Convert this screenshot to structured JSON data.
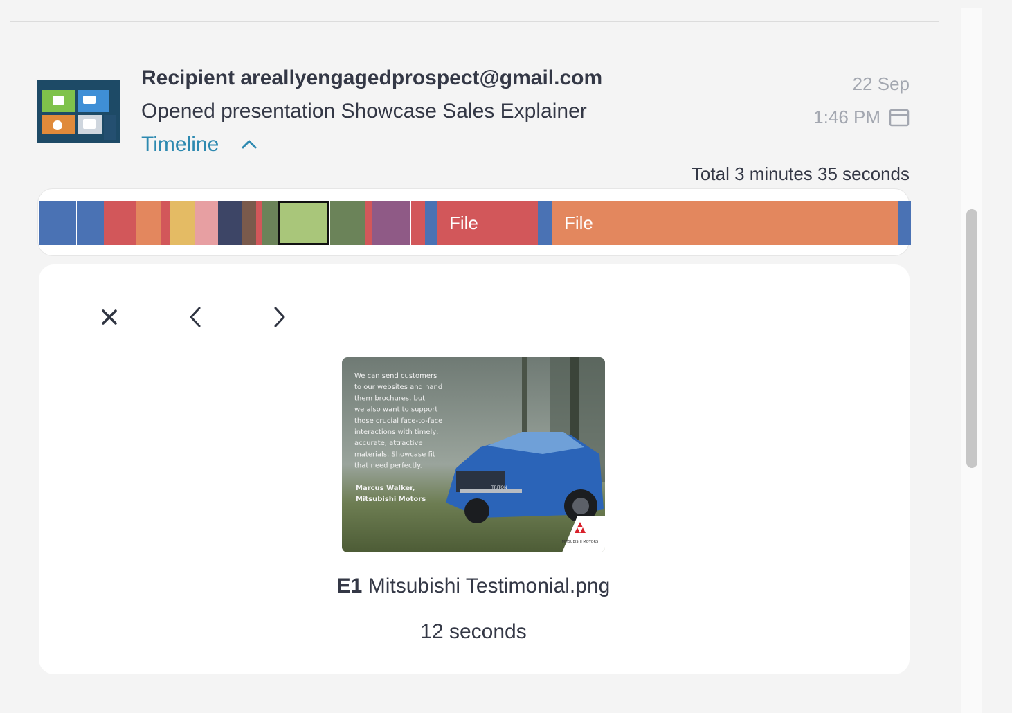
{
  "activity": {
    "recipient_label": "Recipient",
    "recipient_email": "areallyengagedprospect@gmail.com",
    "action": "Opened presentation Showcase Sales Explainer",
    "timeline_label": "Timeline",
    "date": "22 Sep",
    "time": "1:46 PM",
    "total": "Total 3 minutes 35 seconds"
  },
  "timeline": {
    "segments": [
      {
        "color": "#4a72b4",
        "label": "",
        "start": 0.0,
        "end": 0.043
      },
      {
        "color": "#4a72b4",
        "label": "",
        "start": 0.044,
        "end": 0.075
      },
      {
        "color": "#d2575a",
        "label": "",
        "start": 0.075,
        "end": 0.112
      },
      {
        "color": "#e3875e",
        "label": "",
        "start": 0.112,
        "end": 0.14
      },
      {
        "color": "#d2575a",
        "label": "",
        "start": 0.14,
        "end": 0.151
      },
      {
        "color": "#e4bb64",
        "label": "",
        "start": 0.151,
        "end": 0.179
      },
      {
        "color": "#e79fa2",
        "label": "",
        "start": 0.179,
        "end": 0.206
      },
      {
        "color": "#3d4566",
        "label": "",
        "start": 0.206,
        "end": 0.234
      },
      {
        "color": "#7a5a4c",
        "label": "",
        "start": 0.234,
        "end": 0.25
      },
      {
        "color": "#d2575a",
        "label": "",
        "start": 0.25,
        "end": 0.257
      },
      {
        "color": "#6b8359",
        "label": "",
        "start": 0.257,
        "end": 0.275
      },
      {
        "color": "#a9c67a",
        "label": "",
        "start": 0.275,
        "end": 0.335,
        "selected": true
      },
      {
        "color": "#6b8359",
        "label": "",
        "start": 0.335,
        "end": 0.375
      },
      {
        "color": "#d2575a",
        "label": "",
        "start": 0.375,
        "end": 0.384
      },
      {
        "color": "#8f5a86",
        "label": "",
        "start": 0.384,
        "end": 0.428
      },
      {
        "color": "#d2575a",
        "label": "",
        "start": 0.428,
        "end": 0.444
      },
      {
        "color": "#4a72b4",
        "label": "",
        "start": 0.444,
        "end": 0.458
      },
      {
        "color": "#d2575a",
        "label": "File",
        "start": 0.458,
        "end": 0.574
      },
      {
        "color": "#4a72b4",
        "label": "",
        "start": 0.574,
        "end": 0.59
      },
      {
        "color": "#e3875e",
        "label": "File",
        "start": 0.59,
        "end": 0.989
      },
      {
        "color": "#4a72b4",
        "label": "",
        "start": 0.989,
        "end": 1.0
      }
    ]
  },
  "viewer": {
    "close_icon": "close-icon",
    "prev_icon": "chevron-left-icon",
    "next_icon": "chevron-right-icon",
    "file_code": "E1",
    "file_name": "Mitsubishi Testimonial.png",
    "duration": "12 seconds",
    "preview": {
      "quote_lines": [
        "We can send customers",
        "to our websites and hand",
        "them brochures, but",
        "we also want to support",
        "those crucial face-to-face",
        "interactions with timely,",
        "accurate, attractive",
        "materials. Showcase fit",
        "that need perfectly."
      ],
      "author_lines": [
        "Marcus Walker,",
        "Mitsubishi Motors"
      ],
      "vehicle_badge": "TRITON",
      "logo_text": "MITSUBISHI MOTORS"
    }
  }
}
